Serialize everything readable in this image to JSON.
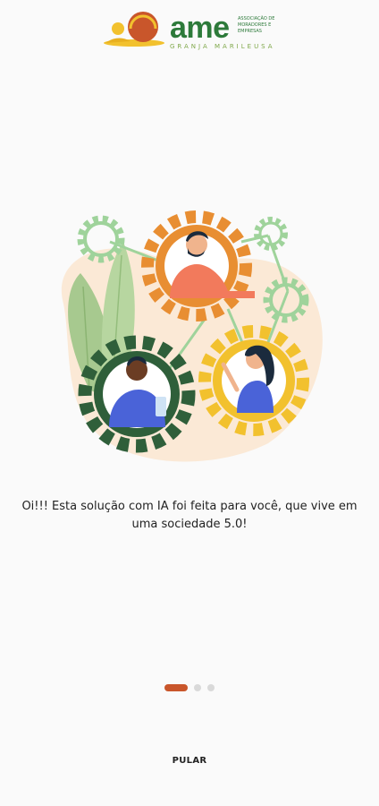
{
  "brand": {
    "name": "ame",
    "subtitle": "Associação de Moradores e Empresas",
    "tagline": "Granja Marileusa",
    "colors": {
      "green": "#2d7a3a",
      "orange": "#c9562b",
      "yellow": "#f2c12e"
    }
  },
  "onboarding": {
    "illustration": "people-connected-by-gears",
    "message": "Oi!!! Esta solução com IA foi feita para você, que vive em uma sociedade 5.0!",
    "pages": {
      "current": 1,
      "total": 3
    },
    "skip_label": "PULAR"
  }
}
